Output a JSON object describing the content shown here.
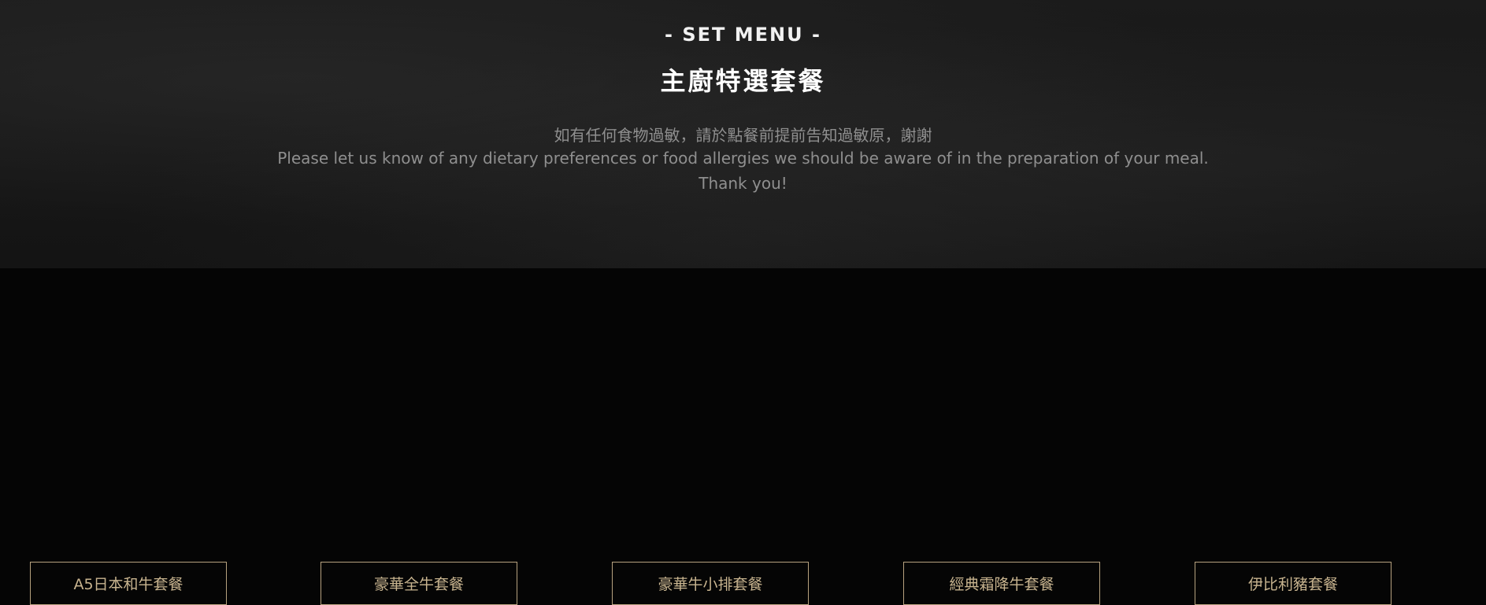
{
  "header": {
    "kicker": "- SET MENU -",
    "title": "主廚特選套餐"
  },
  "notice": {
    "zh": "如有任何食物過敏，請於點餐前提前告知過敏原，謝謝",
    "en_line1": "Please let us know of any dietary preferences or food allergies we should be aware of in the preparation of your meal.",
    "en_line2": "Thank you!"
  },
  "tabs": [
    {
      "label": "A5日本和牛套餐"
    },
    {
      "label": "豪華全牛套餐"
    },
    {
      "label": "豪華牛小排套餐"
    },
    {
      "label": "經典霜降牛套餐"
    },
    {
      "label": "伊比利豬套餐"
    }
  ],
  "colors": {
    "background_dark": "#050505",
    "hero_background": "#171717",
    "accent_gold": "#b7a27f",
    "title_text": "#ffffff",
    "notice_text": "#8f8f8f"
  }
}
